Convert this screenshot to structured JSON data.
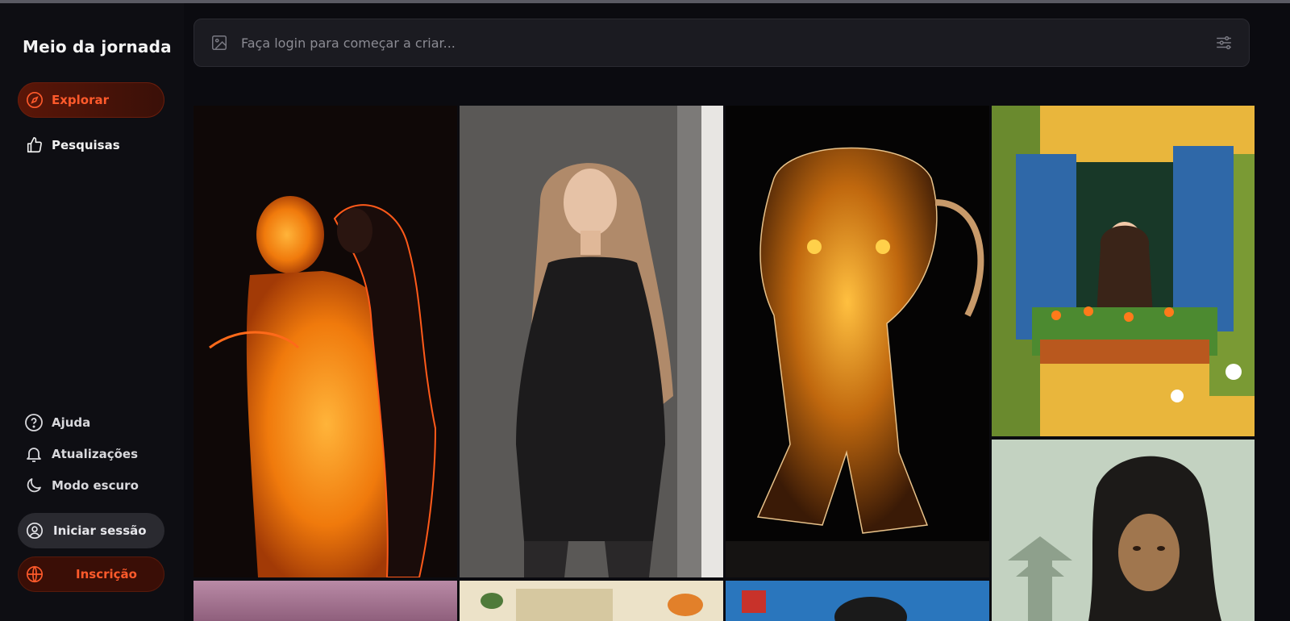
{
  "app": {
    "title": "Meio da jornada"
  },
  "nav": [
    {
      "label": "Explorar",
      "icon": "compass-icon",
      "active": true
    },
    {
      "label": "Pesquisas",
      "icon": "thumbs-up-icon",
      "active": false
    }
  ],
  "footer": [
    {
      "label": "Ajuda",
      "icon": "help-circle-icon"
    },
    {
      "label": "Atualizações",
      "icon": "bell-icon"
    },
    {
      "label": "Modo escuro",
      "icon": "moon-icon"
    }
  ],
  "auth": {
    "login_label": "Iniciar sessão",
    "signup_label": "Inscrição"
  },
  "search": {
    "placeholder": "Faça login para começar a criar..."
  },
  "colors": {
    "accent": "#ff5a2b",
    "background": "#0b0b10",
    "search_bg": "#1b1b21"
  }
}
